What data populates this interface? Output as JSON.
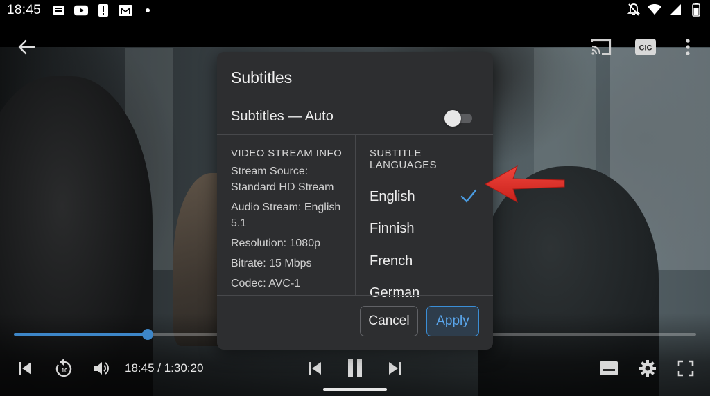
{
  "status_bar": {
    "time": "18:45",
    "left_icons": [
      "notes-icon",
      "youtube-icon",
      "alert-icon",
      "gmail-icon",
      "dot-icon"
    ],
    "right_icons": [
      "notifications-off-icon",
      "wifi-icon",
      "signal-icon",
      "battery-icon"
    ]
  },
  "player": {
    "progress_fraction": 0.196,
    "time_display": "18:45 / 1:30:20",
    "accent_color": "#3d86c8"
  },
  "dialog": {
    "title": "Subtitles",
    "toggle_label": "Subtitles — Auto",
    "toggle_on": false,
    "info_heading": "VIDEO STREAM INFO",
    "info_items": [
      "Stream Source: Standard HD Stream",
      "Audio Stream: English 5.1",
      "Resolution: 1080p",
      "Bitrate: 15 Mbps",
      "Codec: AVC-1"
    ],
    "languages_heading": "SUBTITLE LANGUAGES",
    "languages": [
      {
        "label": "English",
        "selected": true
      },
      {
        "label": "Finnish",
        "selected": false
      },
      {
        "label": "French",
        "selected": false
      },
      {
        "label": "German",
        "selected": false
      }
    ],
    "cancel_label": "Cancel",
    "apply_label": "Apply"
  },
  "top_bar": {
    "cc_label": "CIC"
  }
}
